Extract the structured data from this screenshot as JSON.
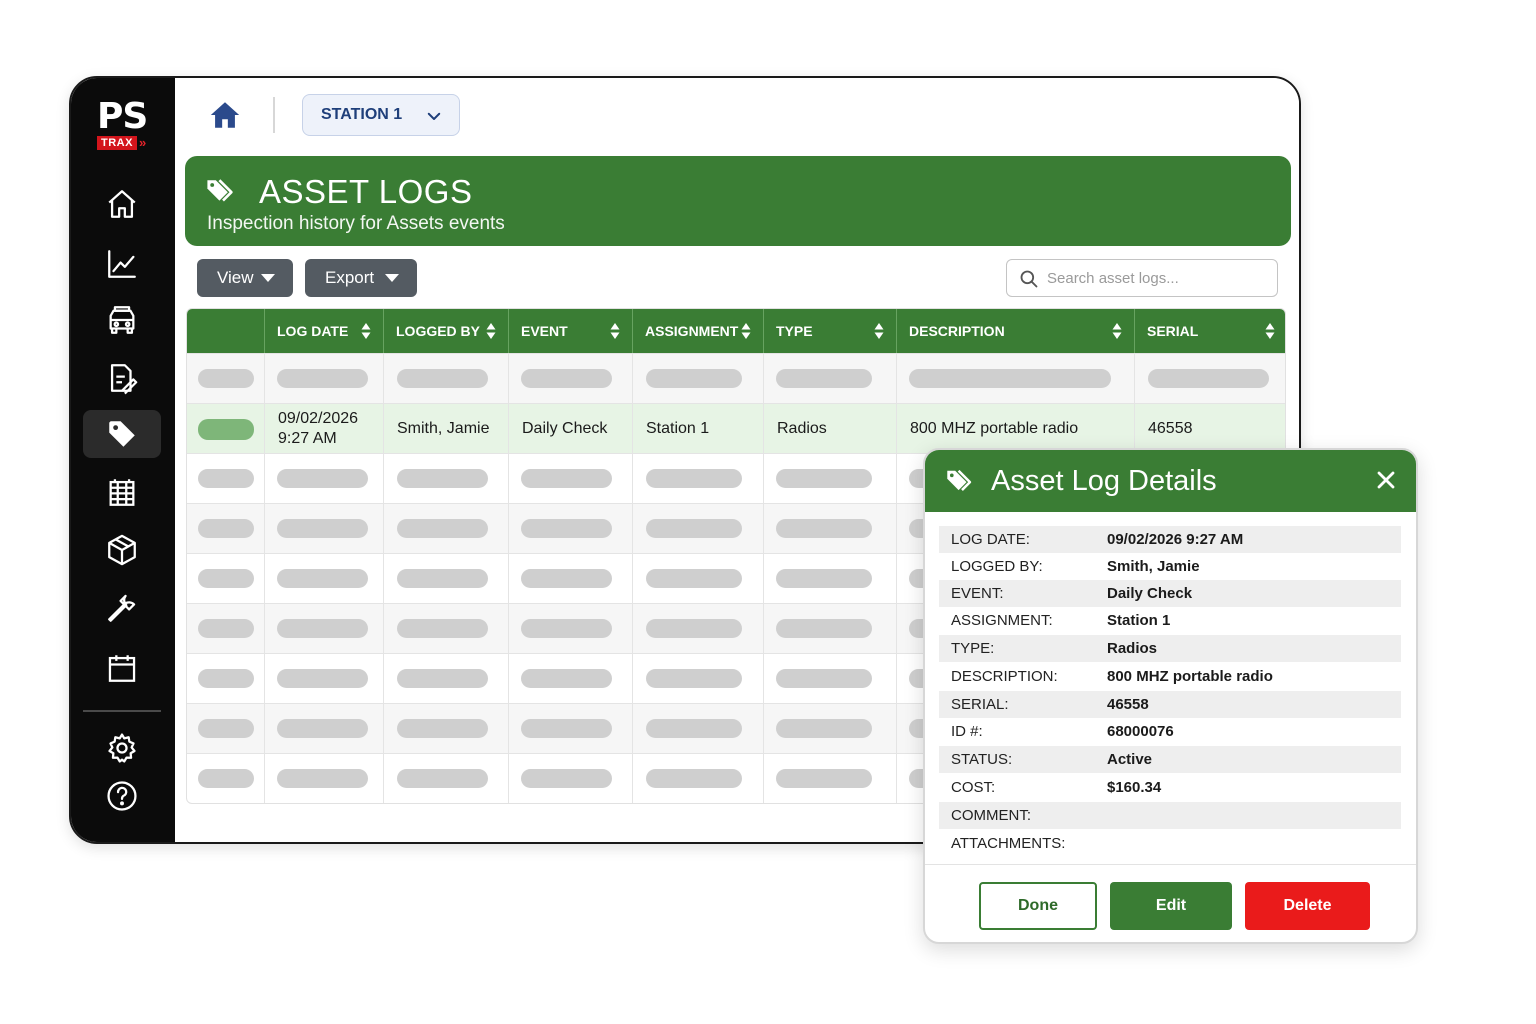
{
  "brand": {
    "logo_text": "PS",
    "logo_sub": "TRAX",
    "logo_arrows": "»"
  },
  "topbar": {
    "station_label": "STATION 1"
  },
  "banner": {
    "title": "ASSET LOGS",
    "subtitle": "Inspection history for Assets events"
  },
  "toolbar": {
    "view_label": "View",
    "export_label": "Export",
    "search_placeholder": "Search asset logs..."
  },
  "table": {
    "columns": [
      "LOG DATE",
      "LOGGED BY",
      "EVENT",
      "ASSIGNMENT",
      "TYPE",
      "DESCRIPTION",
      "SERIAL"
    ],
    "selected_row": {
      "log_date_line1": "09/02/2026",
      "log_date_line2": "9:27 AM",
      "logged_by": "Smith, Jamie",
      "event": "Daily Check",
      "assignment": "Station 1",
      "type": "Radios",
      "description": "800 MHZ portable radio",
      "serial": "46558"
    }
  },
  "modal": {
    "title": "Asset Log Details",
    "fields": [
      {
        "label": "LOG DATE:",
        "value": "09/02/2026 9:27 AM"
      },
      {
        "label": "LOGGED BY:",
        "value": "Smith, Jamie"
      },
      {
        "label": "EVENT:",
        "value": "Daily Check"
      },
      {
        "label": "ASSIGNMENT:",
        "value": "Station 1"
      },
      {
        "label": "TYPE:",
        "value": "Radios"
      },
      {
        "label": "DESCRIPTION:",
        "value": "800 MHZ portable radio"
      },
      {
        "label": "SERIAL:",
        "value": "46558"
      },
      {
        "label": "ID #:",
        "value": "68000076"
      },
      {
        "label": "STATUS:",
        "value": "Active"
      },
      {
        "label": "COST:",
        "value": "$160.34"
      },
      {
        "label": "COMMENT:",
        "value": ""
      },
      {
        "label": "ATTACHMENTS:",
        "value": ""
      }
    ],
    "done_label": "Done",
    "edit_label": "Edit",
    "delete_label": "Delete"
  },
  "colors": {
    "primary_green": "#3a7d34",
    "danger_red": "#ea1b1b",
    "sidebar_bg": "#0b0b0b",
    "station_text": "#1f3f7a"
  },
  "icons": {
    "sidebar": [
      "home-icon",
      "chart-icon",
      "vehicle-icon",
      "forms-icon",
      "tag-icon",
      "building-icon",
      "package-icon",
      "wrench-icon",
      "calendar-icon",
      "gear-icon",
      "help-icon"
    ]
  }
}
